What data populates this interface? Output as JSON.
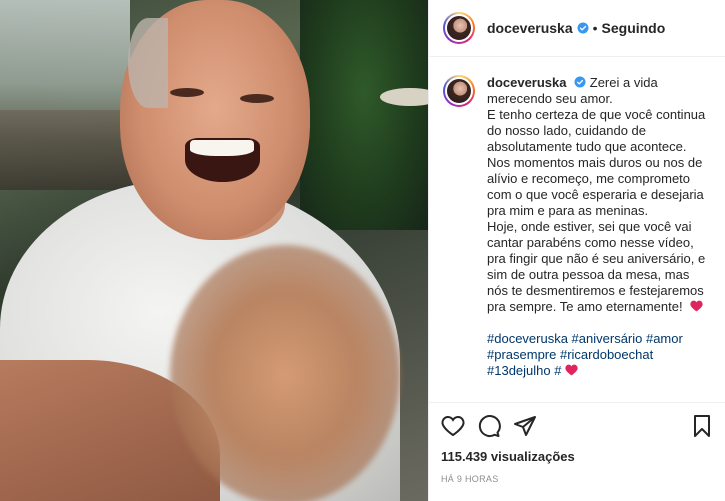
{
  "post": {
    "username": "doceveruska",
    "separator": "•",
    "follow_status": "Seguindo"
  },
  "caption": {
    "username": "doceveruska",
    "lines": [
      "Zerei a vida",
      "merecendo seu amor.",
      "E tenho certeza de que você continua",
      "do nosso lado, cuidando de",
      "absolutamente tudo que acontece.",
      "Nos momentos mais duros ou nos de",
      "alívio e recomeço, me comprometo",
      "com o que você esperaria e desejaria",
      "pra mim e para as meninas.",
      "Hoje, onde estiver, sei que você vai",
      "cantar parabéns como nesse vídeo,",
      "pra fingir que não é seu aniversário, e",
      "sim de outra pessoa da mesa, mas",
      "nós te desmentiremos e festejaremos",
      "pra sempre. Te amo eternamente!"
    ],
    "hashtag_lines": [
      "#doceveruska #aniversário #amor",
      "#prasempre #ricardoboechat",
      "#13dejulho #"
    ]
  },
  "stats": {
    "views": "115.439 visualizações",
    "time": "HÁ 9 HORAS"
  },
  "icons": {
    "like": "heart-outline-icon",
    "comment": "comment-bubble-icon",
    "share": "paper-plane-icon",
    "save": "bookmark-icon",
    "verified": "verified-badge-icon",
    "emoji_heart": "red-heart-emoji"
  },
  "colors": {
    "verified_blue": "#3897f0",
    "hashtag": "#00376b",
    "heart_red": "#e0245e"
  }
}
